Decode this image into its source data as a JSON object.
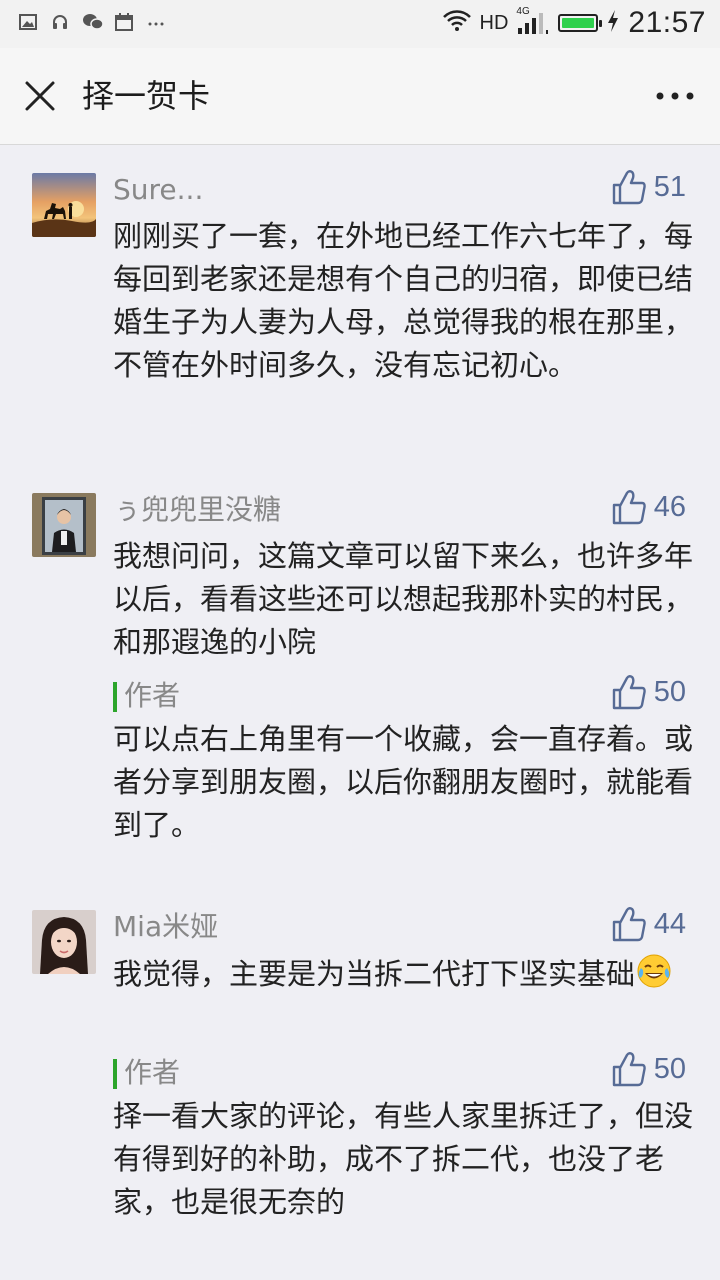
{
  "status_bar": {
    "network": "HD",
    "network_gen": "4G",
    "time": "21:57"
  },
  "header": {
    "title": "择一贺卡"
  },
  "comments": [
    {
      "user": "Sure...",
      "likes": "51",
      "text": "刚刚买了一套，在外地已经工作六七年了，每每回到老家还是想有个自己的归宿，即使已结婚生子为人妻为人母，总觉得我的根在那里，不管在外时间多久，没有忘记初心。"
    },
    {
      "user": "ぅ兜兜里没糖",
      "likes": "46",
      "text": "我想问问，这篇文章可以留下来么，也许多年以后，看看这些还可以想起我那朴实的村民，和那遐逸的小院",
      "reply": {
        "label": "作者",
        "likes": "50",
        "text": "可以点右上角里有一个收藏，会一直存着。或者分享到朋友圈，以后你翻朋友圈时，就能看到了。"
      }
    },
    {
      "user": "Mia米娅",
      "likes": "44",
      "text": "我觉得，主要是为当拆二代打下坚实基础",
      "emoji": "tears-of-joy",
      "reply": {
        "label": "作者",
        "likes": "50",
        "text": "择一看大家的评论，有些人家里拆迁了，但没有得到好的补助，成不了拆二代，也没了老家，也是很无奈的"
      }
    }
  ]
}
